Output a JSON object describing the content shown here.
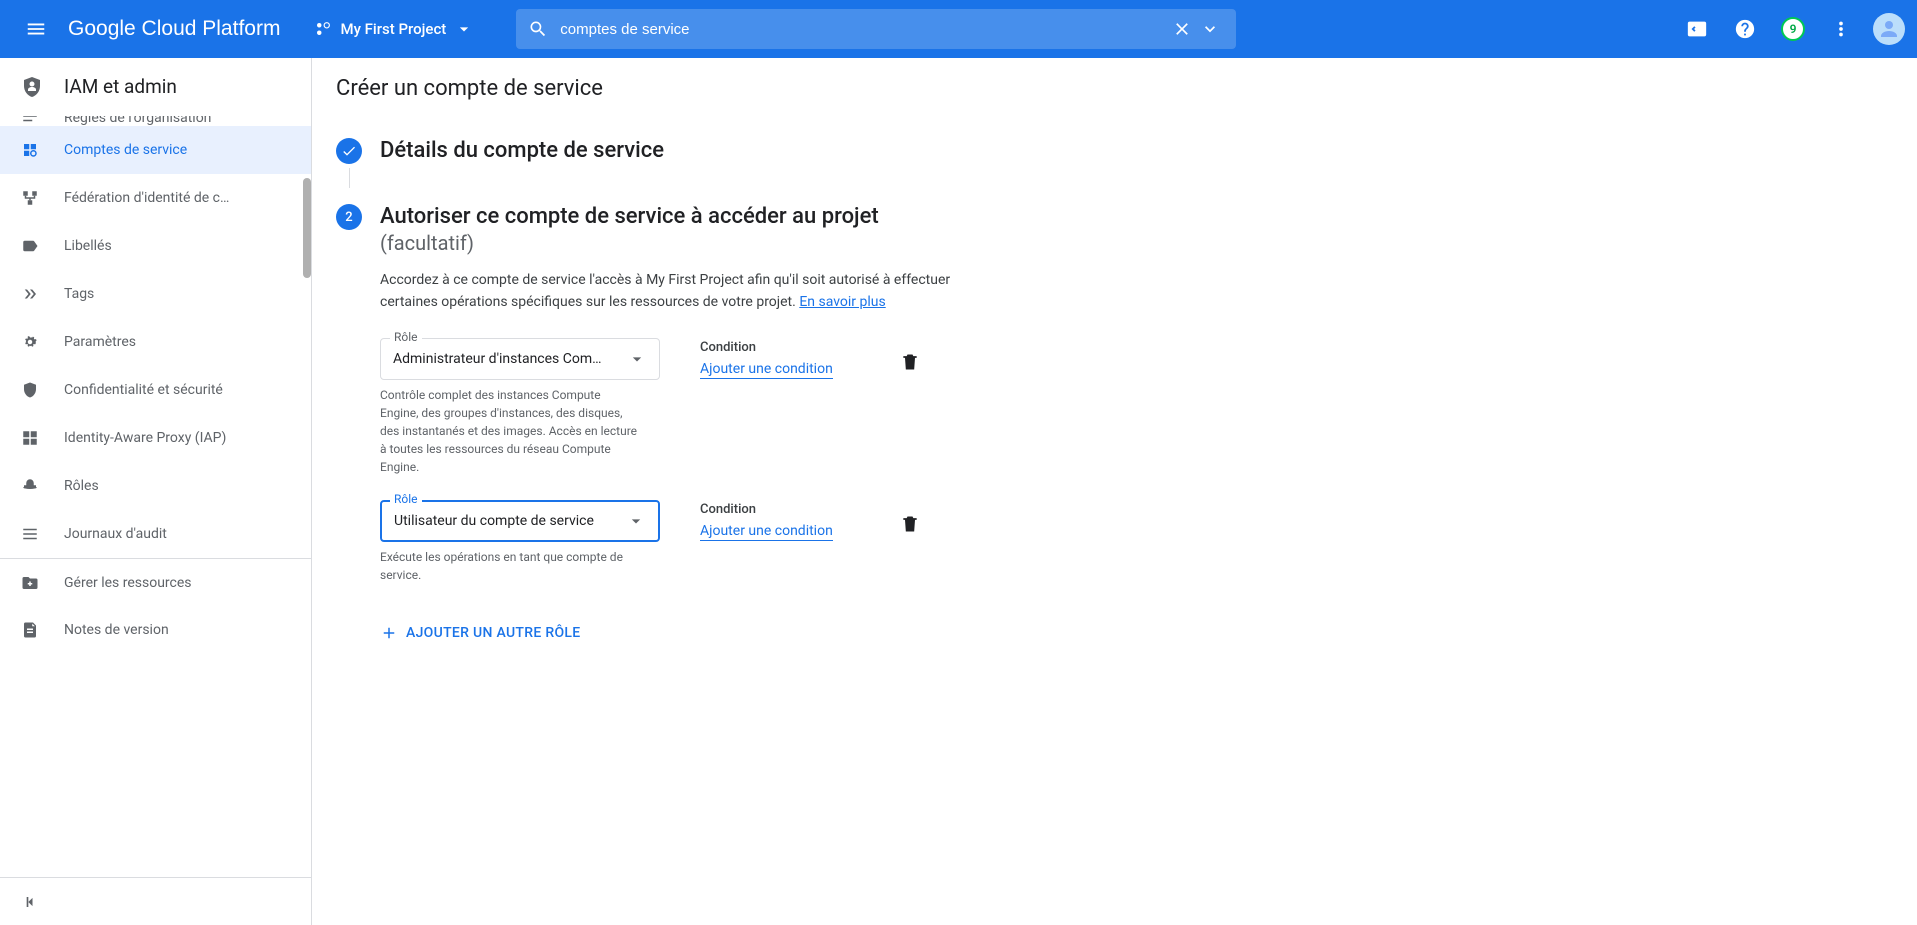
{
  "header": {
    "logo_google": "Google",
    "logo_rest": " Cloud Platform",
    "project_name": "My First Project",
    "search_value": "comptes de service",
    "notification_count": "9"
  },
  "sidebar": {
    "section_title": "IAM et admin",
    "items": [
      {
        "icon": "org-policy",
        "label": "Règles de l'organisation",
        "cutoff": true
      },
      {
        "icon": "service-accounts",
        "label": "Comptes de service",
        "active": true
      },
      {
        "icon": "federation",
        "label": "Fédération d'identité de c…"
      },
      {
        "icon": "label",
        "label": "Libellés"
      },
      {
        "icon": "tag",
        "label": "Tags"
      },
      {
        "icon": "gear",
        "label": "Paramètres"
      },
      {
        "icon": "shield",
        "label": "Confidentialité et sécurité"
      },
      {
        "icon": "iap",
        "label": "Identity-Aware Proxy (IAP)"
      },
      {
        "icon": "hat",
        "label": "Rôles"
      },
      {
        "icon": "audit",
        "label": "Journaux d'audit"
      },
      {
        "icon": "resources",
        "label": "Gérer les ressources",
        "divider": true
      },
      {
        "icon": "notes",
        "label": "Notes de version"
      }
    ]
  },
  "main": {
    "page_title": "Créer un compte de service",
    "step1": {
      "title": "Détails du compte de service"
    },
    "step2": {
      "number": "2",
      "title": "Autoriser ce compte de service à accéder au projet",
      "subtitle": "(facultatif)",
      "desc_part1": "Accordez à ce compte de service l'accès à My First Project afin qu'il soit autorisé à effectuer certaines opérations spécifiques sur les ressources de votre projet. ",
      "desc_link": "En savoir plus"
    },
    "roles": [
      {
        "label": "Rôle",
        "value": "Administrateur d'instances Com…",
        "helper": "Contrôle complet des instances Compute Engine, des groupes d'instances, des disques, des instantanés et des images. Accès en lecture à toutes les ressources du réseau Compute Engine.",
        "condition_label": "Condition",
        "condition_link": "Ajouter une condition",
        "focused": false
      },
      {
        "label": "Rôle",
        "value": "Utilisateur du compte de service",
        "helper": "Exécute les opérations en tant que compte de service.",
        "condition_label": "Condition",
        "condition_link": "Ajouter une condition",
        "focused": true
      }
    ],
    "add_role_label": "AJOUTER UN AUTRE RÔLE"
  }
}
